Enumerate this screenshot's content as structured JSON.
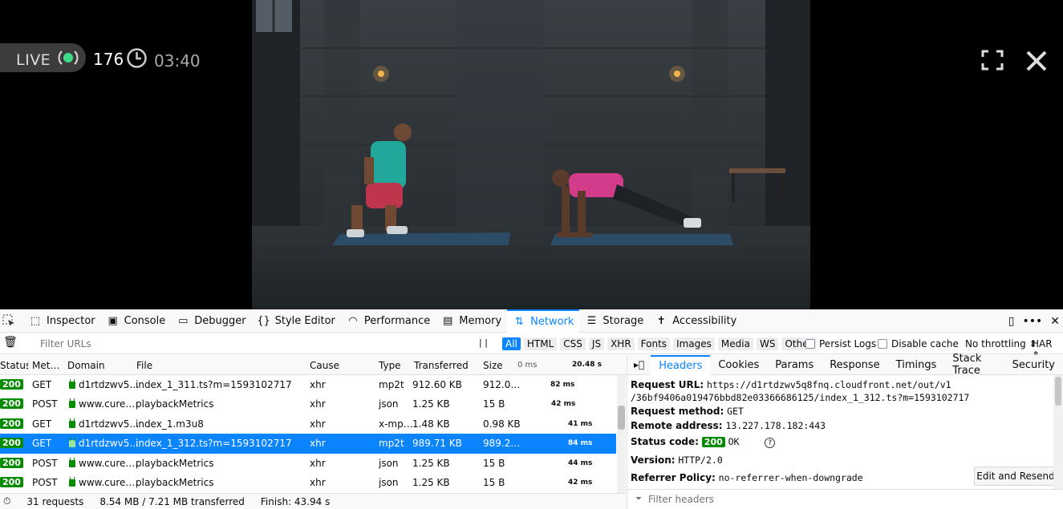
{
  "video": {
    "live_label": "LIVE",
    "viewer_count": "176",
    "duration": "03:40"
  },
  "devtools": {
    "tabs": [
      {
        "label": "Inspector",
        "icon": "inspector-icon"
      },
      {
        "label": "Console",
        "icon": "console-icon"
      },
      {
        "label": "Debugger",
        "icon": "debugger-icon"
      },
      {
        "label": "Style Editor",
        "icon": "braces-icon"
      },
      {
        "label": "Performance",
        "icon": "gauge-icon"
      },
      {
        "label": "Memory",
        "icon": "memory-icon"
      },
      {
        "label": "Network",
        "icon": "arrows-updown-icon"
      },
      {
        "label": "Storage",
        "icon": "storage-icon"
      },
      {
        "label": "Accessibility",
        "icon": "accessibility-icon"
      }
    ],
    "active_tab": "Network",
    "toolbar": {
      "filter_placeholder": "Filter URLs",
      "pause": "| |",
      "type_filters": [
        "All",
        "HTML",
        "CSS",
        "JS",
        "XHR",
        "Fonts",
        "Images",
        "Media",
        "WS",
        "Other"
      ],
      "active_type": "All",
      "persist_logs": "Persist Logs",
      "disable_cache": "Disable cache",
      "throttling": "No throttling",
      "har": "HAR"
    },
    "columns": {
      "status": "Status",
      "method": "Met…",
      "domain": "Domain",
      "file": "File",
      "cause": "Cause",
      "type": "Type",
      "transferred": "Transferred",
      "size": "Size",
      "waterfall_start": "0 ms",
      "waterfall_end": "20.48 s"
    },
    "requests": [
      {
        "status": "200",
        "method": "GET",
        "domain": "d1rtdzwv5…",
        "file": "index_1_311.ts?m=1593102717",
        "cause": "xhr",
        "type": "mp2t",
        "transferred": "912.60 KB",
        "size": "912.0…",
        "time": "82 ms",
        "selected": false
      },
      {
        "status": "200",
        "method": "POST",
        "domain": "www.cure.…",
        "file": "playbackMetrics",
        "cause": "xhr",
        "type": "json",
        "transferred": "1.25 KB",
        "size": "15 B",
        "time": "42 ms",
        "selected": false
      },
      {
        "status": "200",
        "method": "GET",
        "domain": "d1rtdzwv5…",
        "file": "index_1.m3u8",
        "cause": "xhr",
        "type": "x-mp…",
        "transferred": "1.48 KB",
        "size": "0.98 KB",
        "time": "41 ms",
        "selected": false
      },
      {
        "status": "200",
        "method": "GET",
        "domain": "d1rtdzwv5…",
        "file": "index_1_312.ts?m=1593102717",
        "cause": "xhr",
        "type": "mp2t",
        "transferred": "989.71 KB",
        "size": "989.2…",
        "time": "84 ms",
        "selected": true
      },
      {
        "status": "200",
        "method": "POST",
        "domain": "www.cure.…",
        "file": "playbackMetrics",
        "cause": "xhr",
        "type": "json",
        "transferred": "1.25 KB",
        "size": "15 B",
        "time": "44 ms",
        "selected": false
      },
      {
        "status": "200",
        "method": "POST",
        "domain": "www.cure.…",
        "file": "playbackMetrics",
        "cause": "xhr",
        "type": "json",
        "transferred": "1.25 KB",
        "size": "15 B",
        "time": "42 ms",
        "selected": false
      }
    ],
    "status_bar": {
      "requests": "31 requests",
      "transferred": "8.54 MB / 7.21 MB transferred",
      "finish": "Finish: 43.94 s"
    },
    "details": {
      "tabs": [
        "Headers",
        "Cookies",
        "Params",
        "Response",
        "Timings",
        "Stack Trace",
        "Security"
      ],
      "active_tab": "Headers",
      "request_url_label": "Request URL:",
      "request_url_line1": "https://d1rtdzwv5q8fnq.cloudfront.net/out/v1",
      "request_url_line2": "/36bf9406a019476bbd82e03366686125/index_1_312.ts?m=1593102717",
      "request_method_label": "Request method:",
      "request_method": "GET",
      "remote_address_label": "Remote address:",
      "remote_address": "13.227.178.182:443",
      "status_code_label": "Status code:",
      "status_code": "200",
      "status_text": "OK",
      "version_label": "Version:",
      "version": "HTTP/2.0",
      "referrer_label": "Referrer Policy:",
      "referrer": "no-referrer-when-downgrade",
      "edit_resend": "Edit and Resend",
      "filter_headers": "Filter headers"
    }
  }
}
